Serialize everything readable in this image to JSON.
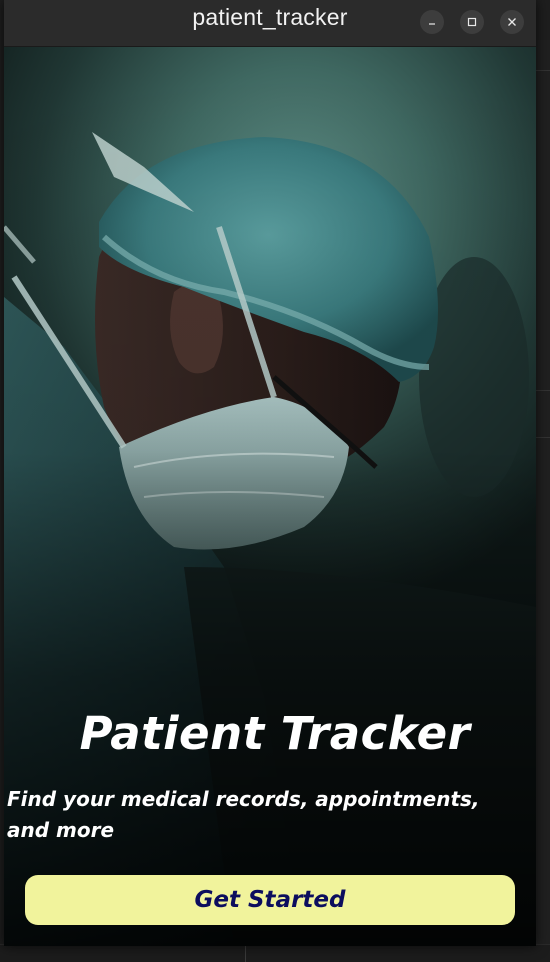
{
  "window": {
    "title": "patient_tracker",
    "controls": {
      "minimize_icon": "minimize-icon",
      "maximize_icon": "maximize-icon",
      "close_icon": "close-icon"
    }
  },
  "hero": {
    "image_icon": "surgeon-photo",
    "title": "Patient Tracker",
    "subtitle": "Find your medical records, appointments, and more",
    "button_label": "Get Started"
  },
  "colors": {
    "button_bg": "#f1f39c",
    "button_text": "#0c0d5e",
    "titlebar": "#2b2b2b",
    "text": "#ffffff"
  }
}
